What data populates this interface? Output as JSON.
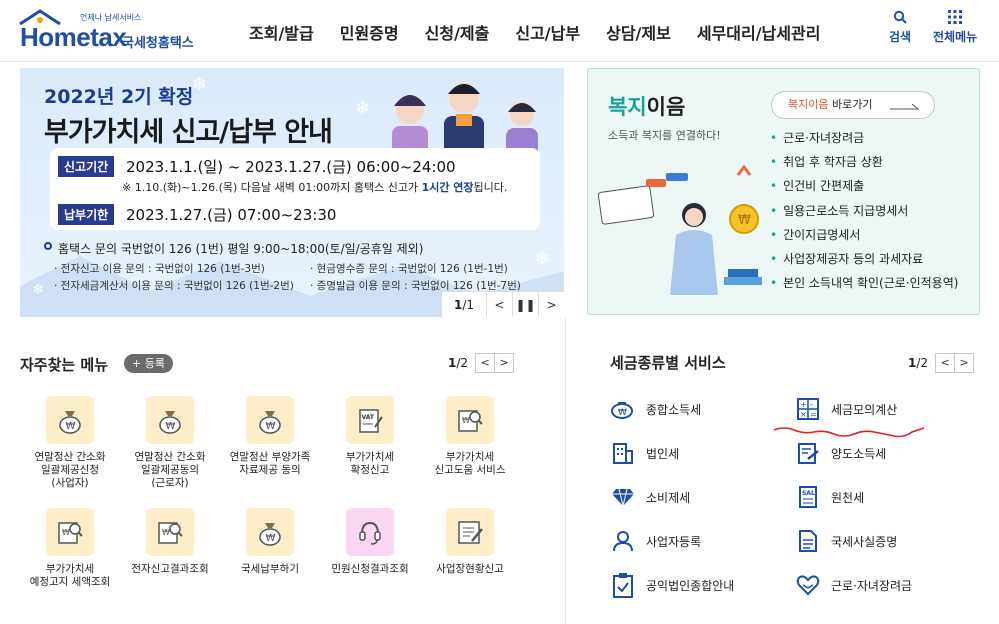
{
  "header": {
    "logo_en": "Hometax",
    "logo_ko": "국세청홈택스",
    "logo_sub": "언제나 납세서비스",
    "nav": [
      "조회/발급",
      "민원증명",
      "신청/제출",
      "신고/납부",
      "상담/제보",
      "세무대리/납세관리"
    ],
    "search_label": "검색",
    "all_menu_label": "전체메뉴"
  },
  "banner": {
    "year": "2022년 2기 확정",
    "title": "부가가치세 신고/납부 안내",
    "period_tag": "신고기간",
    "period": "2023.1.1.(일) ~ 2023.1.27.(금) 06:00~24:00",
    "note_prefix": "※ 1.10.(화)~1.26.(목) 다음날 새벽 01:00까지 홈택스 신고가 ",
    "note_highlight": "1시간 연장",
    "note_suffix": "됩니다.",
    "pay_tag": "납부기한",
    "pay": "2023.1.27.(금) 07:00~23:30",
    "contact": "홈택스 문의 국번없이 126 (1번)  평일 9:00~18:00(토/일/공휴일 제외)",
    "lines": [
      "· 전자신고 이용 문의 : 국번없이 126 (1번-3번)",
      "· 현금영수증 문의 : 국번없이 126 (1번-1번)",
      "· 전자세금계산서 이용 문의 : 국번없이 126 (1번-2번)",
      "· 증명발급 이용 문의 : 국번없이 126 (1번-7번)"
    ],
    "pager_current": "1",
    "pager_total": "1"
  },
  "welfare": {
    "title_highlight": "복지",
    "title_rest": "이음",
    "subtitle": "소득과 복지를 연결하다!",
    "link_highlight": "복지이음",
    "link_rest": " 바로가기",
    "items": [
      "근로·자녀장려금",
      "취업 후 학자금 상환",
      "인건비 간편제출",
      "일용근로소득 지급명세서",
      "간이지급명세서",
      "사업장제공자 등의 과세자료",
      "본인 소득내역 확인(근로·인적용역)"
    ]
  },
  "frequent": {
    "title": "자주찾는 메뉴",
    "register_label": "+ 등록",
    "page_current": "1",
    "page_total": "/2",
    "items": [
      {
        "label": "연말정산 간소화\n일괄제공신청\n(사업자)",
        "icon": "bag-icon"
      },
      {
        "label": "연말정산 간소화\n일괄제공동의\n(근로자)",
        "icon": "bag-icon"
      },
      {
        "label": "연말정산 부양가족\n자료제공 동의",
        "icon": "bag-icon"
      },
      {
        "label": "부가가치세\n확정신고",
        "icon": "vat-icon"
      },
      {
        "label": "부가가치세\n신고도움 서비스",
        "icon": "doc-search-icon"
      },
      {
        "label": "부가가치세\n예정고지 세액조회",
        "icon": "doc-search-icon"
      },
      {
        "label": "전자신고결과조회",
        "icon": "doc-search-icon"
      },
      {
        "label": "국세납부하기",
        "icon": "bag-icon"
      },
      {
        "label": "민원신청결과조회",
        "icon": "headset-icon"
      },
      {
        "label": "사업장현황신고",
        "icon": "doc-pen-icon"
      }
    ]
  },
  "tax": {
    "title": "세금종류별 서비스",
    "page_current": "1",
    "page_total": "/2",
    "items": [
      {
        "label": "종합소득세",
        "icon": "money-bag-icon"
      },
      {
        "label": "세금모의계산",
        "icon": "calculator-icon"
      },
      {
        "label": "법인세",
        "icon": "building-icon"
      },
      {
        "label": "양도소득세",
        "icon": "transfer-doc-icon"
      },
      {
        "label": "소비제세",
        "icon": "diamond-icon"
      },
      {
        "label": "원천세",
        "icon": "receipt-icon"
      },
      {
        "label": "사업자등록",
        "icon": "person-icon"
      },
      {
        "label": "국세사실증명",
        "icon": "document-icon"
      },
      {
        "label": "공익법인종합안내",
        "icon": "clipboard-icon"
      },
      {
        "label": "근로·자녀장려금",
        "icon": "heart-hand-icon"
      }
    ]
  }
}
